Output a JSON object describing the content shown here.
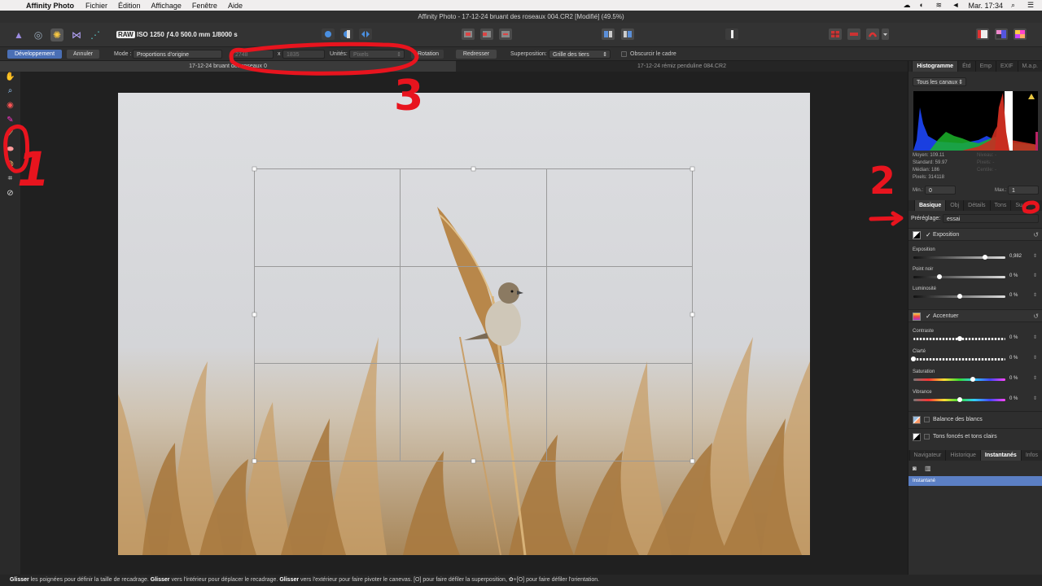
{
  "menubar": {
    "app": "Affinity Photo",
    "menus": [
      "Fichier",
      "Édition",
      "Affichage",
      "Fenêtre",
      "Aide"
    ],
    "clock": "Mar. 17:34"
  },
  "window": {
    "title": "Affinity Photo - 17-12-24 bruant des roseaux 004.CR2 [Modifié] (49.5%)"
  },
  "toolbar": {
    "raw_badge": "RAW",
    "raw_info": "ISO 1250 ƒ4.0 500.0 mm 1/8000 s"
  },
  "context": {
    "develop_label": "Développement",
    "cancel_label": "Annuler",
    "mode_label": "Mode :",
    "mode_value": "Proportions d'origine",
    "width_value": "2748",
    "times": "x",
    "height_value": "1835",
    "units_label": "Unités:",
    "units_value": "Pixels",
    "rotation_label": "Rotation",
    "straighten_label": "Redresser",
    "overlay_label": "Superposition:",
    "overlay_value": "Grille des tiers",
    "darken_label": "Obscurcir le cadre"
  },
  "doc_tabs": [
    "17-12-24 bruant des roseaux 0",
    "17-12-24 rémiz penduline 084.CR2"
  ],
  "right_panel": {
    "top_tabs": [
      "Histogramme",
      "Étd",
      "Emp",
      "EXIF",
      "M.a.p."
    ],
    "channel": "Tous les canaux",
    "stats_left": [
      "Moyen: 109.11",
      "Standard: 59.97",
      "Médian: 186",
      "Pixels: 314118"
    ],
    "stats_right": [
      "Niveau: -",
      "Pixels: -",
      "Centile: -"
    ],
    "min_label": "Min.:",
    "min_value": "0",
    "max_label": "Max.:",
    "max_value": "1",
    "dev_tabs": [
      "Basique",
      "Obj",
      "Détails",
      "Tons",
      "Su"
    ],
    "preset_label": "Préréglage:",
    "preset_value": "essai",
    "exposure_section": {
      "title": "Exposition",
      "sliders": [
        {
          "label": "Exposition",
          "value": "0,982",
          "pos": 0.78,
          "style": "dark"
        },
        {
          "label": "Point noir",
          "value": "0 %",
          "pos": 0.28,
          "style": "dark"
        },
        {
          "label": "Luminosité",
          "value": "0 %",
          "pos": 0.5,
          "style": "dark"
        }
      ]
    },
    "enhance_section": {
      "title": "Accentuer",
      "sliders": [
        {
          "label": "Contraste",
          "value": "0 %",
          "pos": 0.5,
          "style": "check"
        },
        {
          "label": "Clarté",
          "value": "0 %",
          "pos": 0.0,
          "style": "check"
        },
        {
          "label": "Saturation",
          "value": "0 %",
          "pos": 0.65,
          "style": "rainbow"
        },
        {
          "label": "Vibrance",
          "value": "0 %",
          "pos": 0.5,
          "style": "rainbow"
        }
      ]
    },
    "white_balance": "Balance des blancs",
    "shadows_highlights": "Tons foncés et tons clairs",
    "bottom_tabs": [
      "Navigateur",
      "Historique",
      "Instantanés",
      "Infos"
    ],
    "snapshot_item": "Instantané"
  },
  "annotations": [
    "1",
    "2",
    "3"
  ],
  "status": {
    "text_html_parts": [
      {
        "b": true,
        "t": "Glisser"
      },
      {
        "b": false,
        "t": " les poignées pour définir la taille de recadrage. "
      },
      {
        "b": true,
        "t": "Glisser"
      },
      {
        "b": false,
        "t": " vers l'intérieur pour déplacer le recadrage. "
      },
      {
        "b": true,
        "t": "Glisser"
      },
      {
        "b": false,
        "t": " vers l'extérieur pour faire pivoter le canevas. [O] pour faire défiler la superposition, ✿+[O] pour faire défiler l'orientation."
      }
    ]
  },
  "colors": {
    "accent": "#4a6fb5",
    "annotation_red": "#e8141e",
    "snapshot_bg": "#5b7fc4"
  }
}
